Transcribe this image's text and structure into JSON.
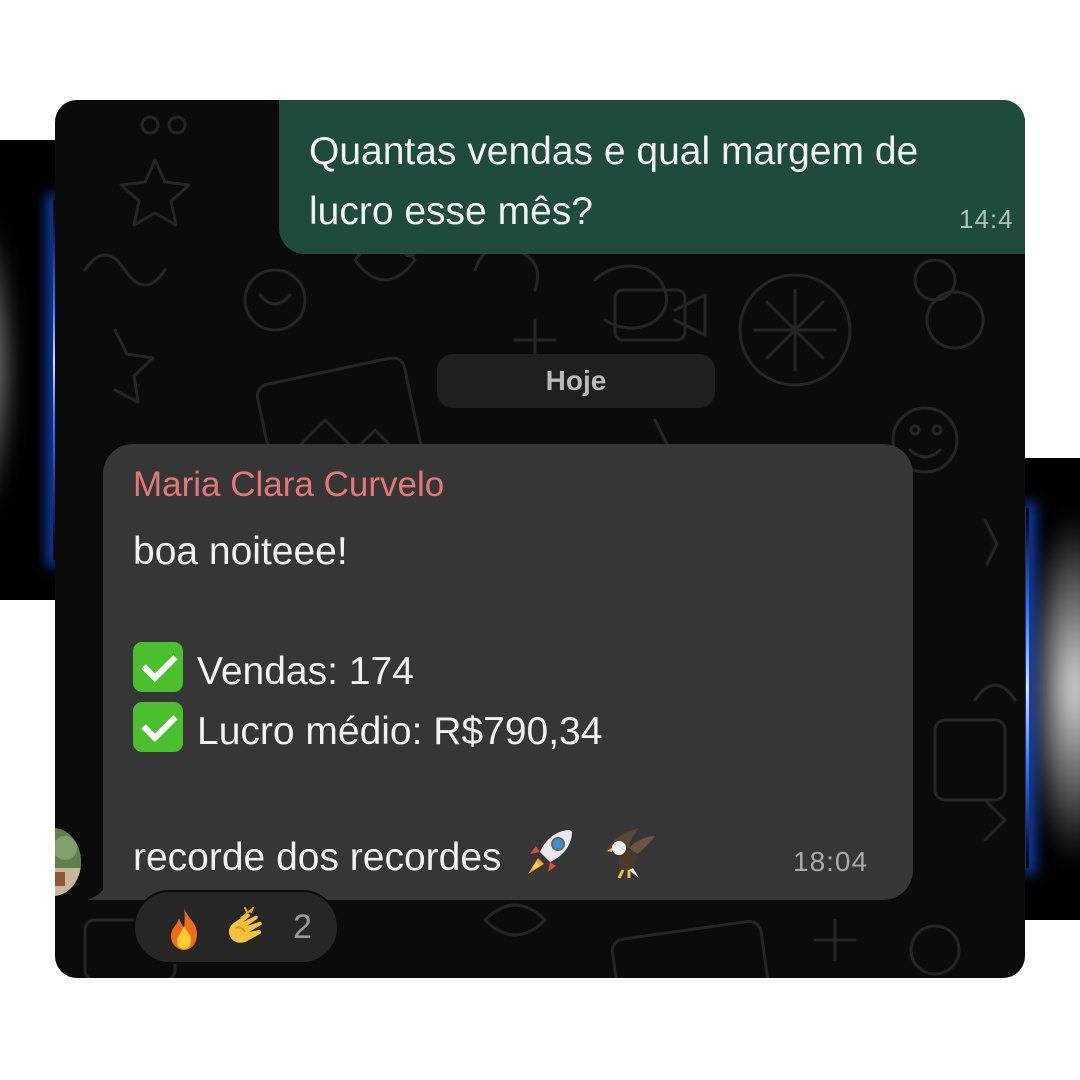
{
  "outgoing_message": {
    "text": "Quantas vendas e qual margem de\nlucro esse mês?",
    "time": "14:4"
  },
  "date_divider": "Hoje",
  "incoming_message": {
    "sender": "Maria Clara Curvelo",
    "greeting": "boa noiteee!",
    "sales_line": "Vendas: 174",
    "profit_line": "Lucro médio: R$790,34",
    "closing": "recorde dos recordes",
    "time": "18:04"
  },
  "reactions": {
    "icons": [
      "fire-icon",
      "clapping-hands-icon"
    ],
    "count": "2"
  },
  "colors": {
    "outgoing_bubble": "#1f4a3e",
    "incoming_bubble": "#363636",
    "sender_name": "#e2787a",
    "chat_background": "#0b0b0b",
    "checkmark": "#4cbf2f"
  }
}
